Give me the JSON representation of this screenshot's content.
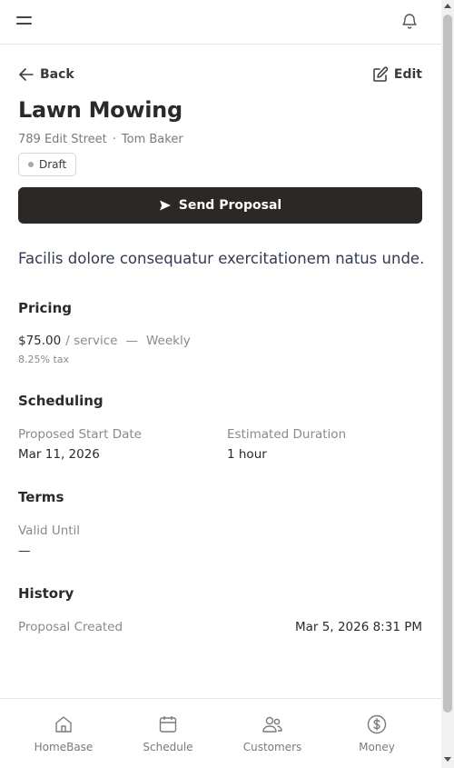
{
  "topbar": {
    "menu_icon": "hamburger-icon",
    "notification_icon": "bell-icon"
  },
  "nav": {
    "back_label": "Back",
    "edit_label": "Edit"
  },
  "proposal": {
    "title": "Lawn Mowing",
    "address": "789 Edit Street",
    "separator": "·",
    "customer": "Tom Baker",
    "status": "Draft",
    "send_label": "Send Proposal",
    "description": "Facilis dolore consequatur exercitationem natus unde."
  },
  "pricing": {
    "heading": "Pricing",
    "price": "$75.00",
    "unit": "/ service",
    "dash": "—",
    "frequency": "Weekly",
    "tax": "8.25% tax"
  },
  "scheduling": {
    "heading": "Scheduling",
    "start_label": "Proposed Start Date",
    "start_value": "Mar 11, 2026",
    "duration_label": "Estimated Duration",
    "duration_value": "1 hour"
  },
  "terms": {
    "heading": "Terms",
    "valid_label": "Valid Until",
    "valid_value": "—"
  },
  "history": {
    "heading": "History",
    "event_label": "Proposal Created",
    "event_time": "Mar 5, 2026 8:31 PM"
  },
  "bottom_nav": {
    "items": [
      {
        "label": "HomeBase",
        "icon": "home-icon"
      },
      {
        "label": "Schedule",
        "icon": "calendar-icon"
      },
      {
        "label": "Customers",
        "icon": "users-icon"
      },
      {
        "label": "Money",
        "icon": "dollar-icon"
      }
    ]
  },
  "colors": {
    "primary_button": "#2b2825",
    "description_text": "#333a55",
    "muted_text": "#8a8a8a"
  }
}
